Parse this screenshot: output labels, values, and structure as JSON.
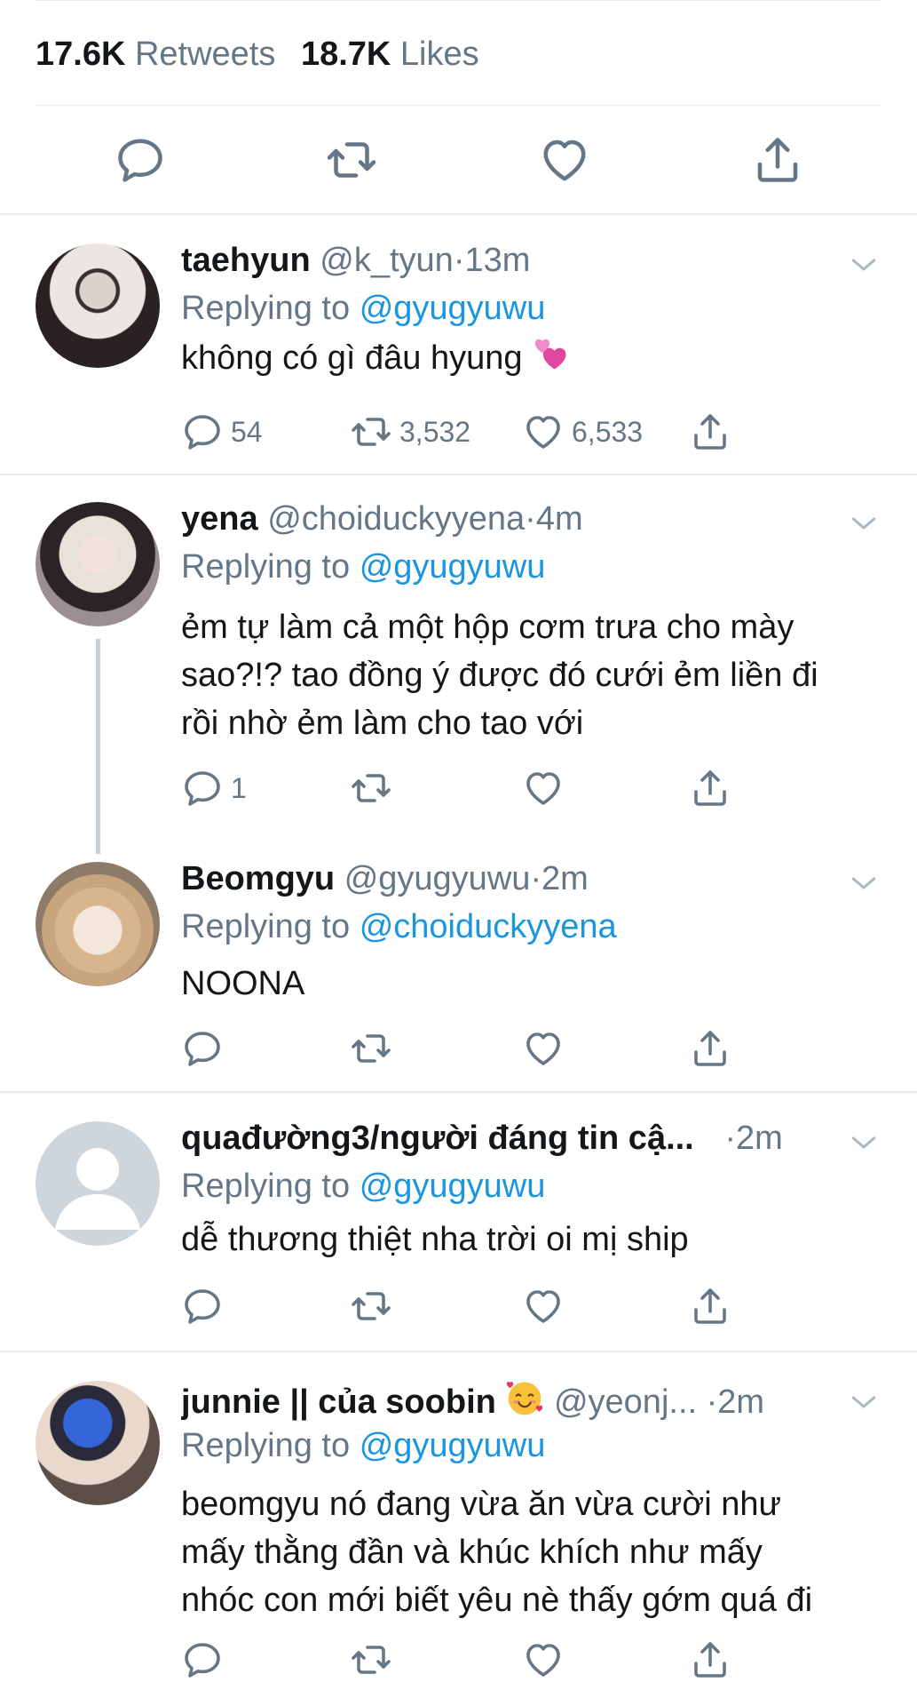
{
  "stats": {
    "retweets_count": "17.6K",
    "retweets_label": "Retweets",
    "likes_count": "18.7K",
    "likes_label": "Likes"
  },
  "icons": {
    "reply": "reply-icon",
    "retweet": "retweet-icon",
    "like": "heart-icon",
    "share": "share-icon",
    "caret": "chevron-down-icon"
  },
  "colors": {
    "link": "#1b95e0",
    "muted": "#657786",
    "text": "#14171a",
    "divider": "#e6ecf0",
    "thread_line": "#c4cfd6"
  },
  "replies": [
    {
      "name": "taehyun",
      "handle": "@k_tyun",
      "separator": "·",
      "time": "13m",
      "replying_to_label": "Replying to",
      "replying_to": "@gyugyuwu",
      "text": "không có gì đâu hyung",
      "emoji": "revolving-hearts-emoji",
      "reply_count": "54",
      "retweet_count": "3,532",
      "like_count": "6,533"
    },
    {
      "name": "yena",
      "handle": "@choiduckyyena",
      "separator": "·",
      "time": "4m",
      "replying_to_label": "Replying to",
      "replying_to": "@gyugyuwu",
      "text_lines": [
        "ẻm tự làm cả một hộp cơm trưa cho mày",
        "sao?!? tao đồng ý được đó cưới ẻm liền đi",
        "rồi nhờ ẻm làm cho tao với"
      ],
      "reply_count": "1"
    },
    {
      "name": "Beomgyu",
      "handle": "@gyugyuwu",
      "separator": "·",
      "time": "2m",
      "replying_to_label": "Replying to",
      "replying_to": "@choiduckyyena",
      "text": "NOONA"
    },
    {
      "name": "quađường3/người đáng tin cậ...",
      "separator": "·",
      "time": "2m",
      "replying_to_label": "Replying to",
      "replying_to": "@gyugyuwu",
      "text": "dễ thương thiệt nha trời oi mị ship"
    },
    {
      "name": "junnie || của soobin",
      "emoji": "smiling-face-with-hearts-emoji",
      "handle": "@yeonj...",
      "separator": "·",
      "time": "2m",
      "replying_to_label": "Replying to",
      "replying_to": "@gyugyuwu",
      "text_lines": [
        "beomgyu nó đang vừa ăn vừa cười như",
        "mấy thằng đần và khúc khích như mấy",
        "nhóc con mới biết yêu nè thấy gớm quá đi"
      ]
    }
  ]
}
